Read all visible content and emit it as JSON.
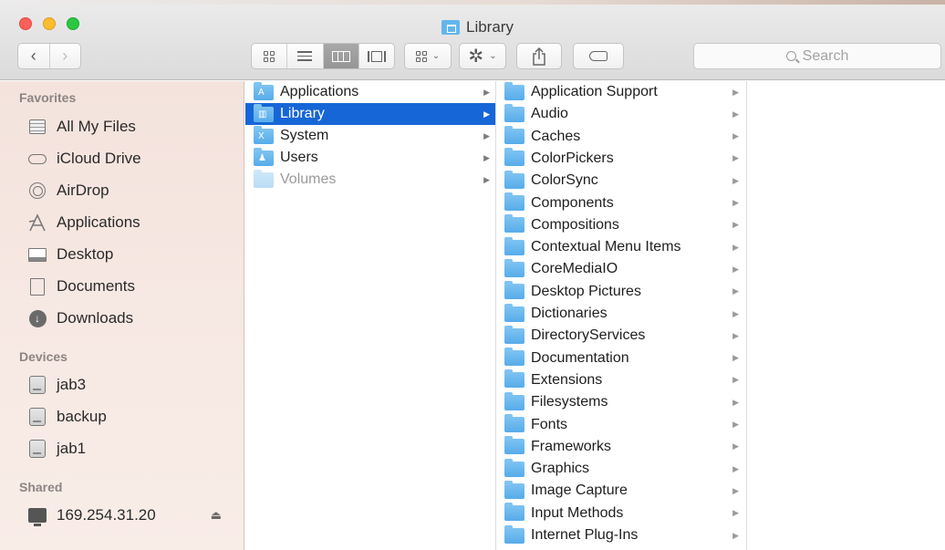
{
  "window": {
    "title": "Library",
    "colors": {
      "selection": "#1766d7",
      "folder": "#56acea",
      "sidebar": "#f6e6e0"
    }
  },
  "toolbar": {
    "back_icon": "‹",
    "forward_icon": "›",
    "view_modes": [
      "icon-view-icon",
      "list-view-icon",
      "column-view-icon",
      "cover-flow-icon"
    ],
    "active_view": "column-view-icon",
    "arrange_icon": "arrange-icon",
    "action_icon": "gear-icon",
    "share_icon": "share-icon",
    "tag_icon": "tag-icon",
    "search_placeholder": "Search"
  },
  "sidebar": {
    "favorites_header": "Favorites",
    "favorites": [
      {
        "label": "All My Files",
        "icon": "all-files-icon"
      },
      {
        "label": "iCloud Drive",
        "icon": "cloud-icon"
      },
      {
        "label": "AirDrop",
        "icon": "airdrop-icon"
      },
      {
        "label": "Applications",
        "icon": "applications-icon"
      },
      {
        "label": "Desktop",
        "icon": "desktop-icon"
      },
      {
        "label": "Documents",
        "icon": "documents-icon"
      },
      {
        "label": "Downloads",
        "icon": "downloads-icon"
      }
    ],
    "devices_header": "Devices",
    "devices": [
      {
        "label": "jab3",
        "icon": "disk-icon"
      },
      {
        "label": "backup",
        "icon": "disk-icon"
      },
      {
        "label": "jab1",
        "icon": "disk-icon"
      }
    ],
    "shared_header": "Shared",
    "shared": [
      {
        "label": "169.254.31.20",
        "icon": "monitor-icon",
        "eject": "⏏"
      }
    ]
  },
  "column1": {
    "items": [
      {
        "label": "Applications",
        "selected": false,
        "dimmed": false
      },
      {
        "label": "Library",
        "selected": true,
        "dimmed": false
      },
      {
        "label": "System",
        "selected": false,
        "dimmed": false
      },
      {
        "label": "Users",
        "selected": false,
        "dimmed": false
      },
      {
        "label": "Volumes",
        "selected": false,
        "dimmed": true
      }
    ]
  },
  "column2": {
    "items": [
      "Application Support",
      "Audio",
      "Caches",
      "ColorPickers",
      "ColorSync",
      "Components",
      "Compositions",
      "Contextual Menu Items",
      "CoreMediaIO",
      "Desktop Pictures",
      "Dictionaries",
      "DirectoryServices",
      "Documentation",
      "Extensions",
      "Filesystems",
      "Fonts",
      "Frameworks",
      "Graphics",
      "Image Capture",
      "Input Methods",
      "Internet Plug-Ins"
    ]
  },
  "disclosure_arrow": "▶"
}
